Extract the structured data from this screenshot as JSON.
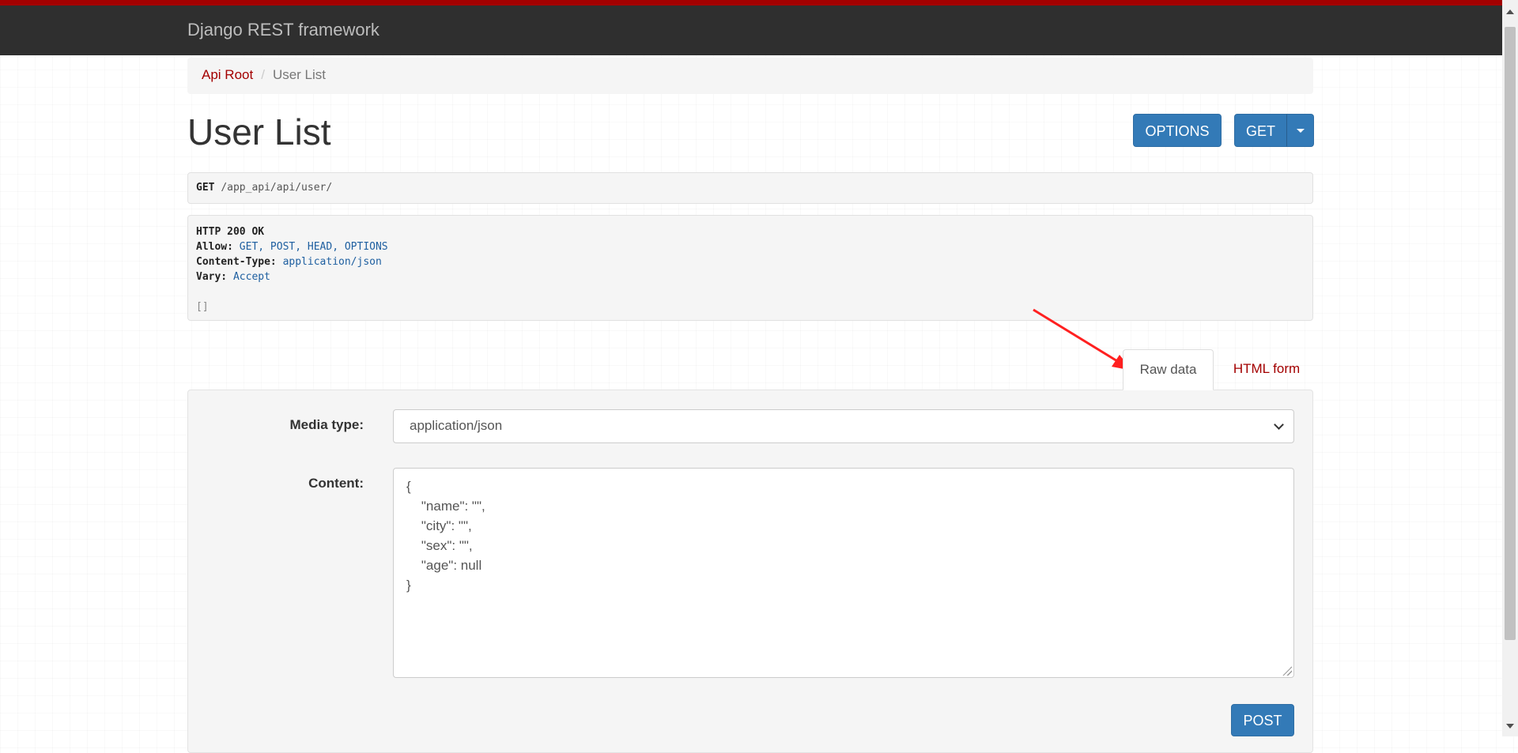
{
  "navbar": {
    "brand": "Django REST framework"
  },
  "breadcrumb": {
    "root": "Api Root",
    "current": "User List"
  },
  "page_title": "User List",
  "buttons": {
    "options": "OPTIONS",
    "get": "GET",
    "post": "POST"
  },
  "request": {
    "method": "GET",
    "path": "/app_api/api/user/"
  },
  "response": {
    "status": "HTTP 200 OK",
    "headers": [
      {
        "key": "Allow:",
        "value": "GET, POST, HEAD, OPTIONS"
      },
      {
        "key": "Content-Type:",
        "value": "application/json"
      },
      {
        "key": "Vary:",
        "value": "Accept"
      }
    ],
    "body": "[]"
  },
  "tabs": {
    "raw": "Raw data",
    "html": "HTML form"
  },
  "form": {
    "media_type_label": "Media type:",
    "media_type_value": "application/json",
    "content_label": "Content:",
    "content_value": "{\n    \"name\": \"\",\n    \"city\": \"\",\n    \"sex\": \"\",\n    \"age\": null\n}"
  },
  "colors": {
    "accent": "#a30000",
    "primary": "#337ab7",
    "navbar": "#2f2f2f",
    "annotation": "#ff2020"
  },
  "icons": {
    "dropdown": "caret-down-icon",
    "select": "chevron-down-icon",
    "annotation": "red-arrow-icon"
  }
}
